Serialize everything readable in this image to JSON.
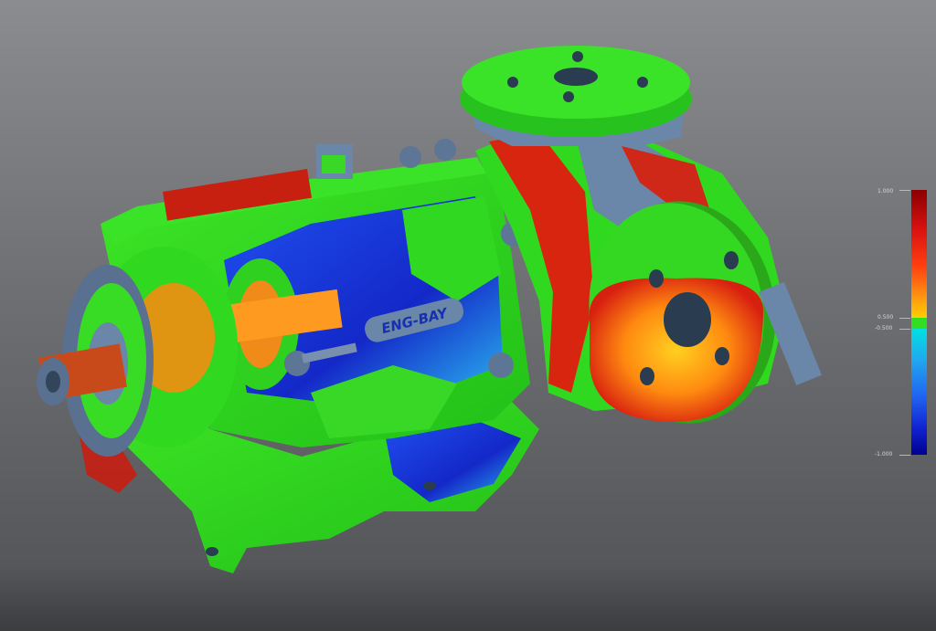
{
  "viewport": {
    "model_logo_text": "ENG-BAY",
    "colors": {
      "background_top": "#8a8c8f",
      "background_bottom": "#4f5154",
      "in_tolerance": "#33dd22",
      "over": "#e02010",
      "under": "#1030e0",
      "mid_warm": "#ff9a10",
      "mid_cool": "#20b8f0",
      "neutral_metal": "#6a86a8"
    }
  },
  "legend": {
    "max_label": "1.000",
    "upper_tol_label": "0.500",
    "lower_tol_label": "-0.500",
    "min_label": "-1.000",
    "max_value": 1.0,
    "upper_tol": 0.5,
    "lower_tol": -0.5,
    "min_value": -1.0
  }
}
